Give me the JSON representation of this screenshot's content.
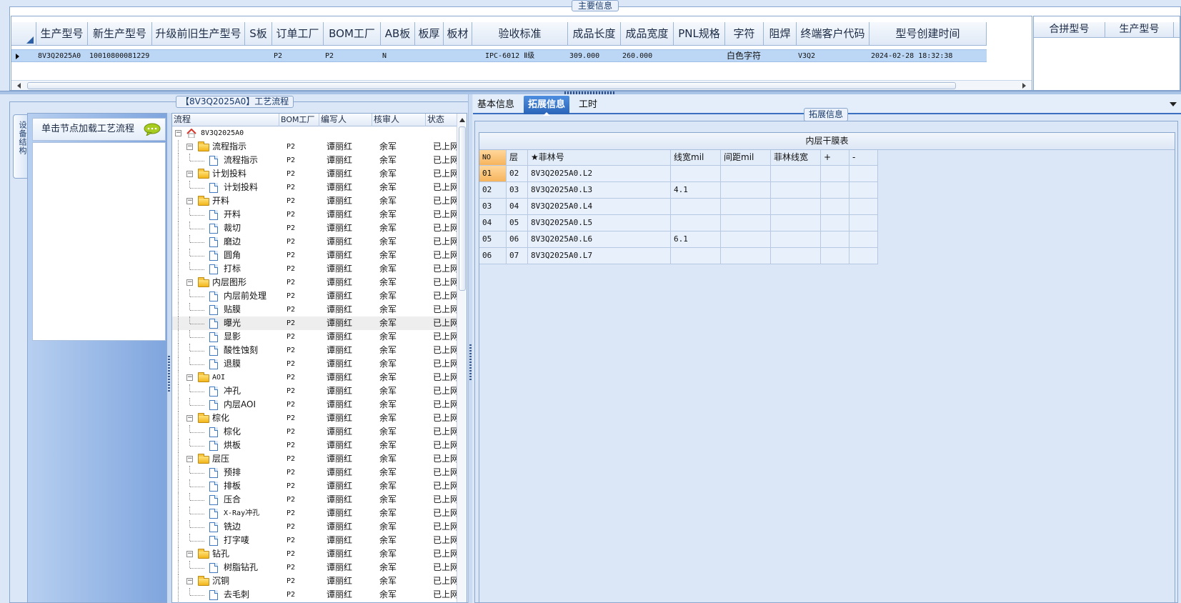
{
  "top_group": {
    "legend": "主要信息",
    "columns": [
      "生产型号",
      "新生产型号",
      "升级前旧生产型号",
      "S板",
      "订单工厂",
      "BOM工厂",
      "AB板",
      "板厚",
      "板材",
      "验收标准",
      "成品长度",
      "成品宽度",
      "PNL规格",
      "字符",
      "阻焊",
      "终端客户代码",
      "型号创建时间"
    ],
    "row": [
      "8V3Q2025A0",
      "10010800081229",
      "",
      "",
      "P2",
      "P2",
      "N",
      "",
      "",
      "IPC-6012 Ⅱ级",
      "309.000",
      "260.000",
      "",
      "白色字符",
      "",
      "V3Q2",
      "2024-02-28 18:32:38"
    ],
    "side_columns": [
      "合拼型号",
      "生产型号"
    ]
  },
  "process_panel": {
    "legend": "【8V3Q2025A0】工艺流程",
    "vertical_tab": "设备结构",
    "hint": "单击节点加载工艺流程",
    "columns": [
      "流程",
      "BOM工厂",
      "编写人",
      "核审人",
      "状态"
    ],
    "rows": [
      {
        "name": "8V3Q2025A0",
        "level": 0,
        "type": "root",
        "bom": "",
        "writer": "",
        "checker": "",
        "status": ""
      },
      {
        "name": "流程指示",
        "level": 1,
        "type": "folder",
        "bom": "P2",
        "writer": "谭丽红",
        "checker": "余军",
        "status": "已上网"
      },
      {
        "name": "流程指示",
        "level": 2,
        "type": "doc",
        "bom": "P2",
        "writer": "谭丽红",
        "checker": "余军",
        "status": "已上网"
      },
      {
        "name": "计划投料",
        "level": 1,
        "type": "folder",
        "bom": "P2",
        "writer": "谭丽红",
        "checker": "余军",
        "status": "已上网"
      },
      {
        "name": "计划投料",
        "level": 2,
        "type": "doc",
        "bom": "P2",
        "writer": "谭丽红",
        "checker": "余军",
        "status": "已上网"
      },
      {
        "name": "开料",
        "level": 1,
        "type": "folder",
        "bom": "P2",
        "writer": "谭丽红",
        "checker": "余军",
        "status": "已上网"
      },
      {
        "name": "开料",
        "level": 2,
        "type": "doc",
        "bom": "P2",
        "writer": "谭丽红",
        "checker": "余军",
        "status": "已上网"
      },
      {
        "name": "裁切",
        "level": 2,
        "type": "doc",
        "bom": "P2",
        "writer": "谭丽红",
        "checker": "余军",
        "status": "已上网"
      },
      {
        "name": "磨边",
        "level": 2,
        "type": "doc",
        "bom": "P2",
        "writer": "谭丽红",
        "checker": "余军",
        "status": "已上网"
      },
      {
        "name": "圆角",
        "level": 2,
        "type": "doc",
        "bom": "P2",
        "writer": "谭丽红",
        "checker": "余军",
        "status": "已上网"
      },
      {
        "name": "打标",
        "level": 2,
        "type": "doc",
        "bom": "P2",
        "writer": "谭丽红",
        "checker": "余军",
        "status": "已上网"
      },
      {
        "name": "内层图形",
        "level": 1,
        "type": "folder",
        "bom": "P2",
        "writer": "谭丽红",
        "checker": "余军",
        "status": "已上网"
      },
      {
        "name": "内层前处理",
        "level": 2,
        "type": "doc",
        "bom": "P2",
        "writer": "谭丽红",
        "checker": "余军",
        "status": "已上网"
      },
      {
        "name": "贴膜",
        "level": 2,
        "type": "doc",
        "bom": "P2",
        "writer": "谭丽红",
        "checker": "余军",
        "status": "已上网"
      },
      {
        "name": "曝光",
        "level": 2,
        "type": "doc",
        "bom": "P2",
        "writer": "谭丽红",
        "checker": "余军",
        "status": "已上网",
        "selected": true
      },
      {
        "name": "显影",
        "level": 2,
        "type": "doc",
        "bom": "P2",
        "writer": "谭丽红",
        "checker": "余军",
        "status": "已上网"
      },
      {
        "name": "酸性蚀刻",
        "level": 2,
        "type": "doc",
        "bom": "P2",
        "writer": "谭丽红",
        "checker": "余军",
        "status": "已上网"
      },
      {
        "name": "退膜",
        "level": 2,
        "type": "doc",
        "bom": "P2",
        "writer": "谭丽红",
        "checker": "余军",
        "status": "已上网"
      },
      {
        "name": "AOI",
        "level": 1,
        "type": "folder",
        "bom": "P2",
        "writer": "谭丽红",
        "checker": "余军",
        "status": "已上网"
      },
      {
        "name": "冲孔",
        "level": 2,
        "type": "doc",
        "bom": "P2",
        "writer": "谭丽红",
        "checker": "余军",
        "status": "已上网"
      },
      {
        "name": "内层AOI",
        "level": 2,
        "type": "doc",
        "bom": "P2",
        "writer": "谭丽红",
        "checker": "余军",
        "status": "已上网"
      },
      {
        "name": "棕化",
        "level": 1,
        "type": "folder",
        "bom": "P2",
        "writer": "谭丽红",
        "checker": "余军",
        "status": "已上网"
      },
      {
        "name": "棕化",
        "level": 2,
        "type": "doc",
        "bom": "P2",
        "writer": "谭丽红",
        "checker": "余军",
        "status": "已上网"
      },
      {
        "name": "烘板",
        "level": 2,
        "type": "doc",
        "bom": "P2",
        "writer": "谭丽红",
        "checker": "余军",
        "status": "已上网"
      },
      {
        "name": "层压",
        "level": 1,
        "type": "folder",
        "bom": "P2",
        "writer": "谭丽红",
        "checker": "余军",
        "status": "已上网"
      },
      {
        "name": "预排",
        "level": 2,
        "type": "doc",
        "bom": "P2",
        "writer": "谭丽红",
        "checker": "余军",
        "status": "已上网"
      },
      {
        "name": "排板",
        "level": 2,
        "type": "doc",
        "bom": "P2",
        "writer": "谭丽红",
        "checker": "余军",
        "status": "已上网"
      },
      {
        "name": "压合",
        "level": 2,
        "type": "doc",
        "bom": "P2",
        "writer": "谭丽红",
        "checker": "余军",
        "status": "已上网"
      },
      {
        "name": "X-Ray冲孔",
        "level": 2,
        "type": "doc",
        "bom": "P2",
        "writer": "谭丽红",
        "checker": "余军",
        "status": "已上网"
      },
      {
        "name": "铣边",
        "level": 2,
        "type": "doc",
        "bom": "P2",
        "writer": "谭丽红",
        "checker": "余军",
        "status": "已上网"
      },
      {
        "name": "打字唛",
        "level": 2,
        "type": "doc",
        "bom": "P2",
        "writer": "谭丽红",
        "checker": "余军",
        "status": "已上网"
      },
      {
        "name": "钻孔",
        "level": 1,
        "type": "folder",
        "bom": "P2",
        "writer": "谭丽红",
        "checker": "余军",
        "status": "已上网"
      },
      {
        "name": "树脂钻孔",
        "level": 2,
        "type": "doc",
        "bom": "P2",
        "writer": "谭丽红",
        "checker": "余军",
        "status": "已上网"
      },
      {
        "name": "沉铜",
        "level": 1,
        "type": "folder",
        "bom": "P2",
        "writer": "谭丽红",
        "checker": "余军",
        "status": "已上网"
      },
      {
        "name": "去毛刺",
        "level": 2,
        "type": "doc",
        "bom": "P2",
        "writer": "谭丽红",
        "checker": "余军",
        "status": "已上网"
      }
    ]
  },
  "right_panel": {
    "tabs": [
      {
        "label": "基本信息",
        "active": false
      },
      {
        "label": "拓展信息",
        "active": true
      },
      {
        "label": "工时",
        "active": false
      }
    ],
    "legend": "拓展信息",
    "table_title": "内层干膜表",
    "columns": [
      "NO",
      "层",
      "★菲林号",
      "线宽mil",
      "间距mil",
      "菲林线宽",
      "+",
      "-"
    ],
    "rows": [
      [
        "01",
        "02",
        "8V3Q2025A0.L2",
        "",
        "",
        "",
        "",
        ""
      ],
      [
        "02",
        "03",
        "8V3Q2025A0.L3",
        "4.1",
        "",
        "",
        "",
        ""
      ],
      [
        "03",
        "04",
        "8V3Q2025A0.L4",
        "",
        "",
        "",
        "",
        ""
      ],
      [
        "04",
        "05",
        "8V3Q2025A0.L5",
        "",
        "",
        "",
        "",
        ""
      ],
      [
        "05",
        "06",
        "8V3Q2025A0.L6",
        "6.1",
        "",
        "",
        "",
        ""
      ],
      [
        "06",
        "07",
        "8V3Q2025A0.L7",
        "",
        "",
        "",
        "",
        ""
      ]
    ]
  },
  "colors": {
    "background": "#dbe7f7",
    "selection": "#bcd7f6",
    "accent": "#2a64b8",
    "row_header_active": "#f6b45c"
  }
}
